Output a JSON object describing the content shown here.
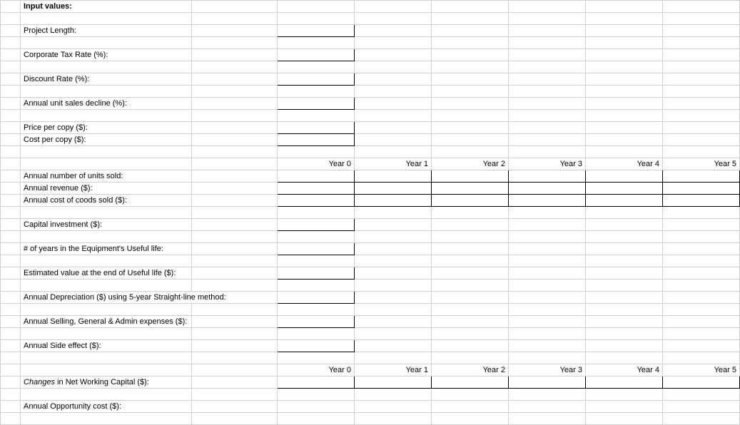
{
  "title": "Input values:",
  "labels": {
    "project_length": "Project Length:",
    "corp_tax_rate": "Corporate Tax Rate (%):",
    "discount_rate": "Discount Rate (%):",
    "annual_decline": "Annual unit sales decline (%):",
    "price_per_copy": "Price per copy ($):",
    "cost_per_copy": "Cost per copy ($):",
    "annual_units": "Annual number of units sold:",
    "annual_revenue": "Annual revenue ($):",
    "annual_cogs": "Annual cost of coods sold ($):",
    "capital_inv": "Capital investment ($):",
    "useful_life": "# of years in the Equipment's Useful life:",
    "est_value": "Estimated value at the end of Useful life ($):",
    "depreciation": "Annual Depreciation ($) using 5-year Straight-line method:",
    "sga": "Annual Selling, General & Admin expenses ($):",
    "side_effect": "Annual Side effect ($):",
    "nwc_changes_prefix": "Changes",
    "nwc_changes_suffix": " in Net Working Capital ($):",
    "opp_cost": "Annual Opportunity cost ($):"
  },
  "years": [
    "Year 0",
    "Year 1",
    "Year 2",
    "Year 3",
    "Year 4",
    "Year 5"
  ],
  "chart_data": {
    "type": "table",
    "title": "Input values spreadsheet",
    "inputs": {
      "project_length": null,
      "corporate_tax_rate_pct": null,
      "discount_rate_pct": null,
      "annual_unit_sales_decline_pct": null,
      "price_per_copy_usd": null,
      "cost_per_copy_usd": null,
      "capital_investment_usd": null,
      "useful_life_years": null,
      "estimated_end_value_usd": null,
      "annual_depreciation_usd": null,
      "annual_sga_expenses_usd": null,
      "annual_side_effect_usd": null,
      "annual_opportunity_cost_usd": null
    },
    "yearly_tables": [
      {
        "rows": [
          "Annual number of units sold",
          "Annual revenue ($)",
          "Annual cost of coods sold ($)"
        ],
        "columns": [
          "Year 0",
          "Year 1",
          "Year 2",
          "Year 3",
          "Year 4",
          "Year 5"
        ],
        "values": [
          [
            null,
            null,
            null,
            null,
            null,
            null
          ],
          [
            null,
            null,
            null,
            null,
            null,
            null
          ],
          [
            null,
            null,
            null,
            null,
            null,
            null
          ]
        ]
      },
      {
        "rows": [
          "Changes in Net Working Capital ($)"
        ],
        "columns": [
          "Year 0",
          "Year 1",
          "Year 2",
          "Year 3",
          "Year 4",
          "Year 5"
        ],
        "values": [
          [
            null,
            null,
            null,
            null,
            null,
            null
          ]
        ]
      }
    ]
  }
}
